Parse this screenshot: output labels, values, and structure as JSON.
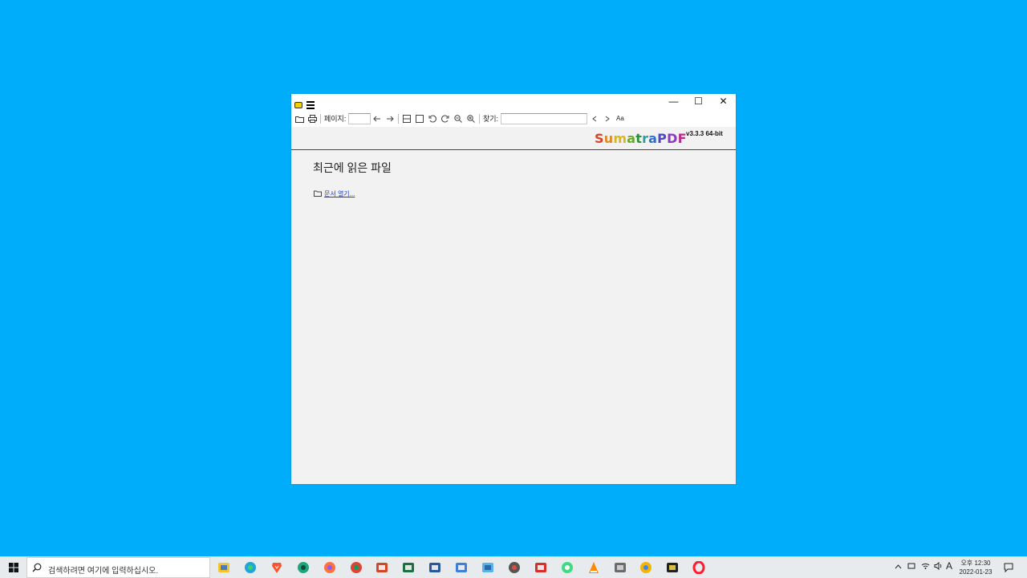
{
  "window": {
    "controls": {
      "minimize": "—",
      "maximize": "☐",
      "close": "✕"
    }
  },
  "toolbar": {
    "page_label": "페이지:",
    "page_value": "",
    "find_label": "찾기:",
    "find_value": "",
    "match_case": "Aa"
  },
  "brand": {
    "letters": [
      "S",
      "u",
      "m",
      "a",
      "t",
      "r",
      "a",
      "P",
      "D",
      "F"
    ],
    "colors": [
      "#d6452a",
      "#e18b1f",
      "#d9b61c",
      "#6aa82d",
      "#2c8f3d",
      "#2aa0a0",
      "#2f6fd0",
      "#4f49c8",
      "#8a3cc0",
      "#c02b8a"
    ],
    "version": "v3.3.3 64-bit"
  },
  "home": {
    "recent_title": "최근에 읽은 파일",
    "open_document": "문서 열기..."
  },
  "taskbar": {
    "search_placeholder": "검색하려면 여기에 입력하십시오.",
    "apps": [
      "file-explorer",
      "edge",
      "brave",
      "vpn-app",
      "firefox",
      "chrome",
      "powerpoint",
      "excel",
      "word",
      "notepad-app",
      "remote-desktop",
      "search-tool",
      "screen-editor",
      "android-app",
      "vlc",
      "calculator",
      "chrome-canary",
      "sticky-notes",
      "opera"
    ],
    "ime": "A",
    "clock_line1": "오후 12:30",
    "clock_line2": "2022-01-23"
  }
}
